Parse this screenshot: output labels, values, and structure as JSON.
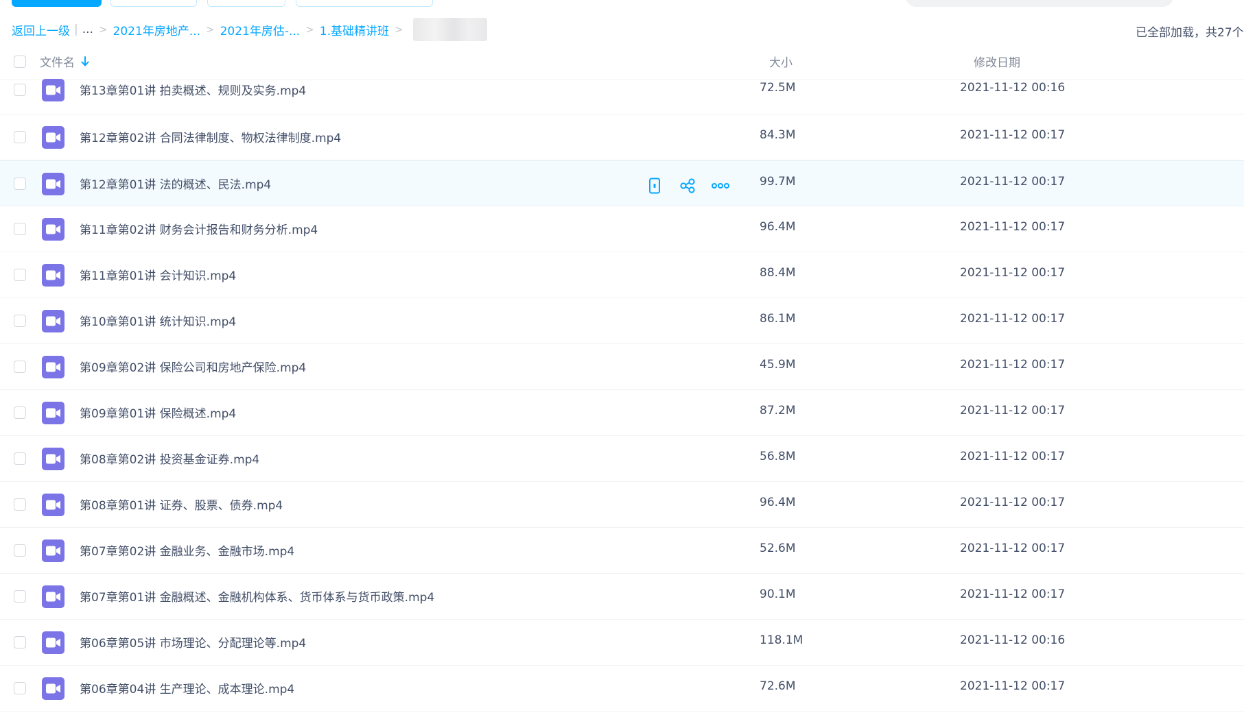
{
  "toolbar": {
    "buttons": [
      "upload-button",
      "new-folder-button",
      "offline-download-button",
      "more-tools-button"
    ]
  },
  "breadcrumb": {
    "back_label": "返回上一级",
    "ellipsis": "...",
    "items": [
      "2021年房地产...",
      "2021年房估-...",
      "1.基础精讲班"
    ]
  },
  "status": {
    "load_text": "已全部加载，共27个"
  },
  "table": {
    "headers": {
      "name": "文件名",
      "size": "大小",
      "date": "修改日期"
    },
    "sort_icon": "arrow-down-icon",
    "rows": [
      {
        "name": "第13章第01讲   拍卖概述、规则及实务.mp4",
        "size": "72.5M",
        "date": "2021-11-12 00:16"
      },
      {
        "name": "第12章第02讲   合同法律制度、物权法律制度.mp4",
        "size": "84.3M",
        "date": "2021-11-12 00:17"
      },
      {
        "name": "第12章第01讲   法的概述、民法.mp4",
        "size": "99.7M",
        "date": "2021-11-12 00:17",
        "hovered": true
      },
      {
        "name": "第11章第02讲   财务会计报告和财务分析.mp4",
        "size": "96.4M",
        "date": "2021-11-12 00:17"
      },
      {
        "name": "第11章第01讲   会计知识.mp4",
        "size": "88.4M",
        "date": "2021-11-12 00:17"
      },
      {
        "name": "第10章第01讲   统计知识.mp4",
        "size": "86.1M",
        "date": "2021-11-12 00:17"
      },
      {
        "name": "第09章第02讲   保险公司和房地产保险.mp4",
        "size": "45.9M",
        "date": "2021-11-12 00:17"
      },
      {
        "name": "第09章第01讲   保险概述.mp4",
        "size": "87.2M",
        "date": "2021-11-12 00:17"
      },
      {
        "name": "第08章第02讲   投资基金证券.mp4",
        "size": "56.8M",
        "date": "2021-11-12 00:17"
      },
      {
        "name": "第08章第01讲   证券、股票、债券.mp4",
        "size": "96.4M",
        "date": "2021-11-12 00:17"
      },
      {
        "name": "第07章第02讲   金融业务、金融市场.mp4",
        "size": "52.6M",
        "date": "2021-11-12 00:17"
      },
      {
        "name": "第07章第01讲   金融概述、金融机构体系、货币体系与货币政策.mp4",
        "size": "90.1M",
        "date": "2021-11-12 00:17"
      },
      {
        "name": "第06章第05讲   市场理论、分配理论等.mp4",
        "size": "118.1M",
        "date": "2021-11-12 00:16"
      },
      {
        "name": "第06章第04讲   生产理论、成本理论.mp4",
        "size": "72.6M",
        "date": "2021-11-12 00:17"
      }
    ],
    "row_actions": [
      "phone-icon",
      "share-icon",
      "more-icon"
    ]
  },
  "colors": {
    "accent": "#06a7ff",
    "video_icon": "#7b74e7",
    "text": "#424e67",
    "header_text": "#818999",
    "hover_row": "#f4fbff"
  }
}
